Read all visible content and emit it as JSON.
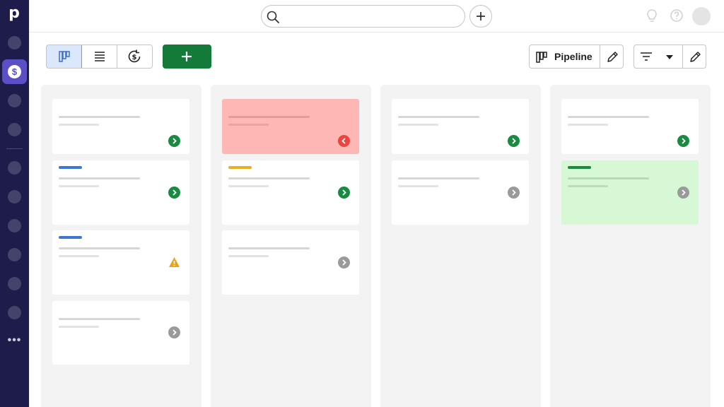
{
  "app": {
    "logo": "p"
  },
  "sidebar": {
    "active_icon": "dollar-coin-icon",
    "more_label": "•••"
  },
  "topbar": {
    "search_placeholder": "",
    "search_value": ""
  },
  "toolbar": {
    "add_label": "+",
    "pipeline_label": "Pipeline"
  },
  "colors": {
    "sidebar": "#1e1c4a",
    "accent_purple": "#5a4fc6",
    "primary_green": "#137a3a",
    "status_green": "#1a8a43",
    "status_gray": "#9a9a9a",
    "status_red": "#e8463f",
    "warning": "#e8a317",
    "tag_blue": "#3a78d4",
    "tag_yellow": "#e8b021",
    "tag_green": "#1a8a43"
  }
}
